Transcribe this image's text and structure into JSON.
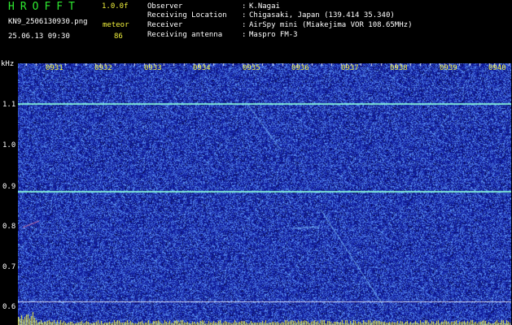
{
  "app": {
    "title": "HROFFT",
    "version": "1.0.0f",
    "filename": "KN9_2506130930.png",
    "station_type": "meteor",
    "timestamp": "25.06.13 09:30",
    "count": "86"
  },
  "info": {
    "observer_label": "Observer",
    "observer_value": "K.Nagai",
    "location_label": "Receiving Location",
    "location_value": "Chigasaki, Japan (139.414 35.340)",
    "receiver_label": "Receiver",
    "receiver_value": "AirSpy mini (Miakejima VOR 108.65MHz)",
    "antenna_label": "Receiving antenna",
    "antenna_value": "Maspro FM-3",
    "colon": ":"
  },
  "axes": {
    "unit": "kHz",
    "time_ticks": [
      "0931",
      "0932",
      "0933",
      "0934",
      "0935",
      "0936",
      "0937",
      "0938",
      "0939",
      "0940"
    ],
    "freq_ticks": [
      "1.1",
      "1.0",
      "0.9",
      "0.8",
      "0.7",
      "0.6"
    ]
  },
  "colors": {
    "background": "#000000",
    "waterfall": "#101c9c",
    "carrier": "#7fe8d8",
    "title_green": "#2ee830",
    "label_yellow": "#f2f23c"
  }
}
